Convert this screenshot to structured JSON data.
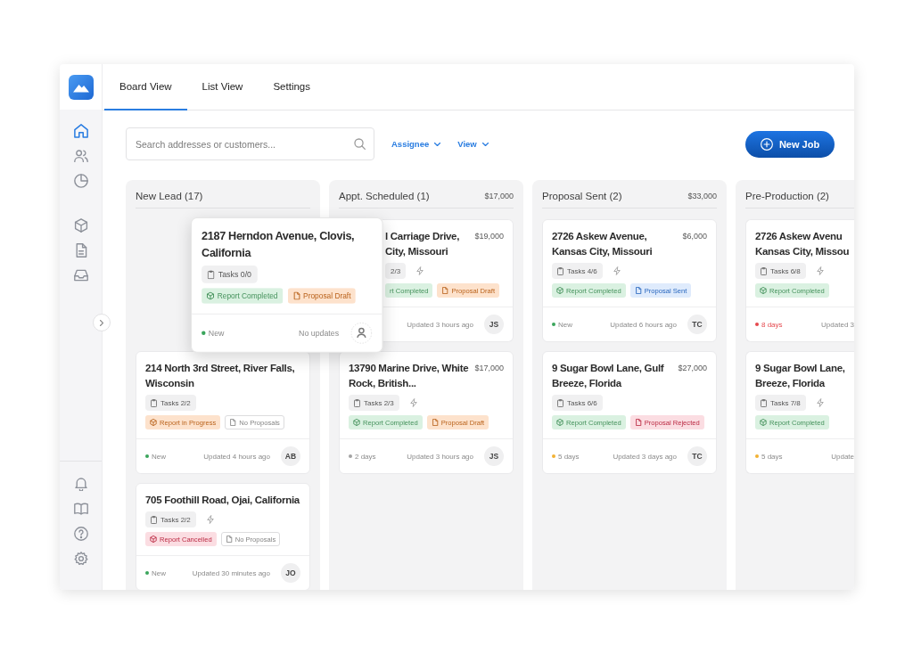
{
  "sidebar": {
    "groups": [
      {
        "items": [
          {
            "selected": true
          },
          {
            "selected": false
          },
          {
            "selected": false
          }
        ]
      },
      {
        "items": [
          {
            "selected": false
          },
          {
            "selected": false
          },
          {
            "selected": false
          }
        ]
      },
      {
        "items": [
          {
            "selected": false
          },
          {
            "selected": false
          },
          {
            "selected": false
          },
          {
            "selected": false
          }
        ]
      }
    ]
  },
  "tabs": [
    {
      "label": "Board View",
      "selected": true
    },
    {
      "label": "List View",
      "selected": false
    },
    {
      "label": "Settings",
      "selected": false
    }
  ],
  "toolbar": {
    "search": {
      "placeholder": "Search addresses or customers..."
    },
    "filters": [
      {
        "label": "Assignee"
      },
      {
        "label": "View"
      }
    ],
    "new_job_button": {
      "label": "New Job"
    }
  },
  "board": {
    "columns": [
      {
        "title": "New Lead (17)",
        "cards": [
          {
            "kind": "dragging",
            "title": "2187 Herndon Avenue, Clovis, California",
            "tasks": "Tasks 0/0",
            "bolt": false,
            "tags": [
              {
                "kind": "report",
                "label": "Report Completed",
                "color": "#daf1e1",
                "outlined": false
              },
              {
                "kind": "proposal",
                "label": "Proposal Draft",
                "color": "#fde2cc",
                "outlined": false
              }
            ],
            "status": {
              "label": "New",
              "color": "#3aa55b",
              "alert": false
            },
            "updated": "No updates",
            "avatar": {
              "kind": "unassigned"
            }
          },
          {
            "kind": "job",
            "title": "214 North 3rd Street, River Falls, Wisconsin",
            "tasks": "Tasks 2/2",
            "bolt": false,
            "tags": [
              {
                "kind": "report",
                "label": "Report in Progress",
                "color": "#fde2cc",
                "outlined": false
              },
              {
                "kind": "proposal",
                "label": "No Proposals",
                "color": "#ffffff",
                "outlined": true
              }
            ],
            "status": {
              "label": "New",
              "color": "#3aa55b",
              "alert": false
            },
            "updated": "Updated 4 hours ago",
            "avatar": {
              "kind": "initials",
              "text": "AB"
            }
          },
          {
            "kind": "job",
            "title": "705 Foothill Road, Ojai, California",
            "tasks": "Tasks 2/2",
            "bolt": true,
            "tags": [
              {
                "kind": "report",
                "label": "Report Cancelled",
                "color": "#fbdde2",
                "outlined": false
              },
              {
                "kind": "proposal",
                "label": "No Proposals",
                "color": "#ffffff",
                "outlined": true
              }
            ],
            "status": {
              "label": "New",
              "color": "#3aa55b",
              "alert": false
            },
            "updated": "Updated 30 minutes ago",
            "avatar": {
              "kind": "initials",
              "text": "JO"
            }
          }
        ]
      },
      {
        "title": "Appt. Scheduled (1)",
        "total": "$17,000",
        "cards": [
          {
            "kind": "covered",
            "title": "l Carriage Drive, City, Missouri",
            "price": "$19,000",
            "tasks": "2/3",
            "bolt": true,
            "tags": [
              {
                "kind": "report",
                "label": "rt Completed",
                "color": "#daf1e1",
                "outlined": false
              },
              {
                "kind": "proposal",
                "label": "Proposal Draft",
                "color": "#fde2cc",
                "outlined": false
              }
            ],
            "updated": "Updated 3 hours ago",
            "avatar": {
              "kind": "initials",
              "text": "JS"
            }
          },
          {
            "kind": "job",
            "title": "13790 Marine Drive, White Rock, British...",
            "price": "$17,000",
            "tasks": "Tasks 2/3",
            "bolt": true,
            "tags": [
              {
                "kind": "report",
                "label": "Report Completed",
                "color": "#daf1e1",
                "outlined": false
              },
              {
                "kind": "proposal",
                "label": "Proposal Draft",
                "color": "#fde2cc",
                "outlined": false
              }
            ],
            "status": {
              "label": "2 days",
              "color": "#a3a3a3",
              "alert": false
            },
            "updated": "Updated 3 hours ago",
            "avatar": {
              "kind": "initials",
              "text": "JS"
            }
          }
        ]
      },
      {
        "title": "Proposal Sent (2)",
        "total": "$33,000",
        "cards": [
          {
            "kind": "job",
            "title": "2726 Askew Avenue, Kansas City, Missouri",
            "price": "$6,000",
            "tasks": "Tasks 4/6",
            "bolt": true,
            "tags": [
              {
                "kind": "report",
                "label": "Report Completed",
                "color": "#daf1e1",
                "outlined": false
              },
              {
                "kind": "proposal",
                "label": "Proposal Sent",
                "color": "#dfebfc",
                "outlined": false
              }
            ],
            "status": {
              "label": "New",
              "color": "#3aa55b",
              "alert": false
            },
            "updated": "Updated 6 hours ago",
            "avatar": {
              "kind": "initials",
              "text": "TC"
            }
          },
          {
            "kind": "job",
            "title": "9 Sugar Bowl Lane, Gulf Breeze, Florida",
            "price": "$27,000",
            "tasks": "Tasks 6/6",
            "bolt": false,
            "tags": [
              {
                "kind": "report",
                "label": "Report Completed",
                "color": "#daf1e1",
                "outlined": false
              },
              {
                "kind": "proposal",
                "label": "Proposal Rejected",
                "color": "#fbdde2",
                "outlined": false
              }
            ],
            "status": {
              "label": "5 days",
              "color": "#f2b233",
              "alert": false
            },
            "updated": "Updated 3 days ago",
            "avatar": {
              "kind": "initials",
              "text": "TC"
            }
          }
        ]
      },
      {
        "title": "Pre-Production (2)",
        "cards": [
          {
            "kind": "job",
            "title": "2726 Askew Avenu Kansas City, Missou",
            "tasks": "Tasks 6/8",
            "bolt": true,
            "tags": [
              {
                "kind": "report",
                "label": "Report Completed",
                "color": "#daf1e1",
                "outlined": false
              }
            ],
            "status": {
              "label": "8 days",
              "color": "#e5484d",
              "alert": true
            },
            "updated": "Updated 3"
          },
          {
            "kind": "job",
            "title": "9 Sugar Bowl Lane, Breeze, Florida",
            "tasks": "Tasks 7/8",
            "bolt": true,
            "tags": [
              {
                "kind": "report",
                "label": "Report Completed",
                "color": "#daf1e1",
                "outlined": false
              }
            ],
            "status": {
              "label": "5 days",
              "color": "#f2b233",
              "alert": false
            },
            "updated": "Update"
          }
        ]
      }
    ]
  }
}
